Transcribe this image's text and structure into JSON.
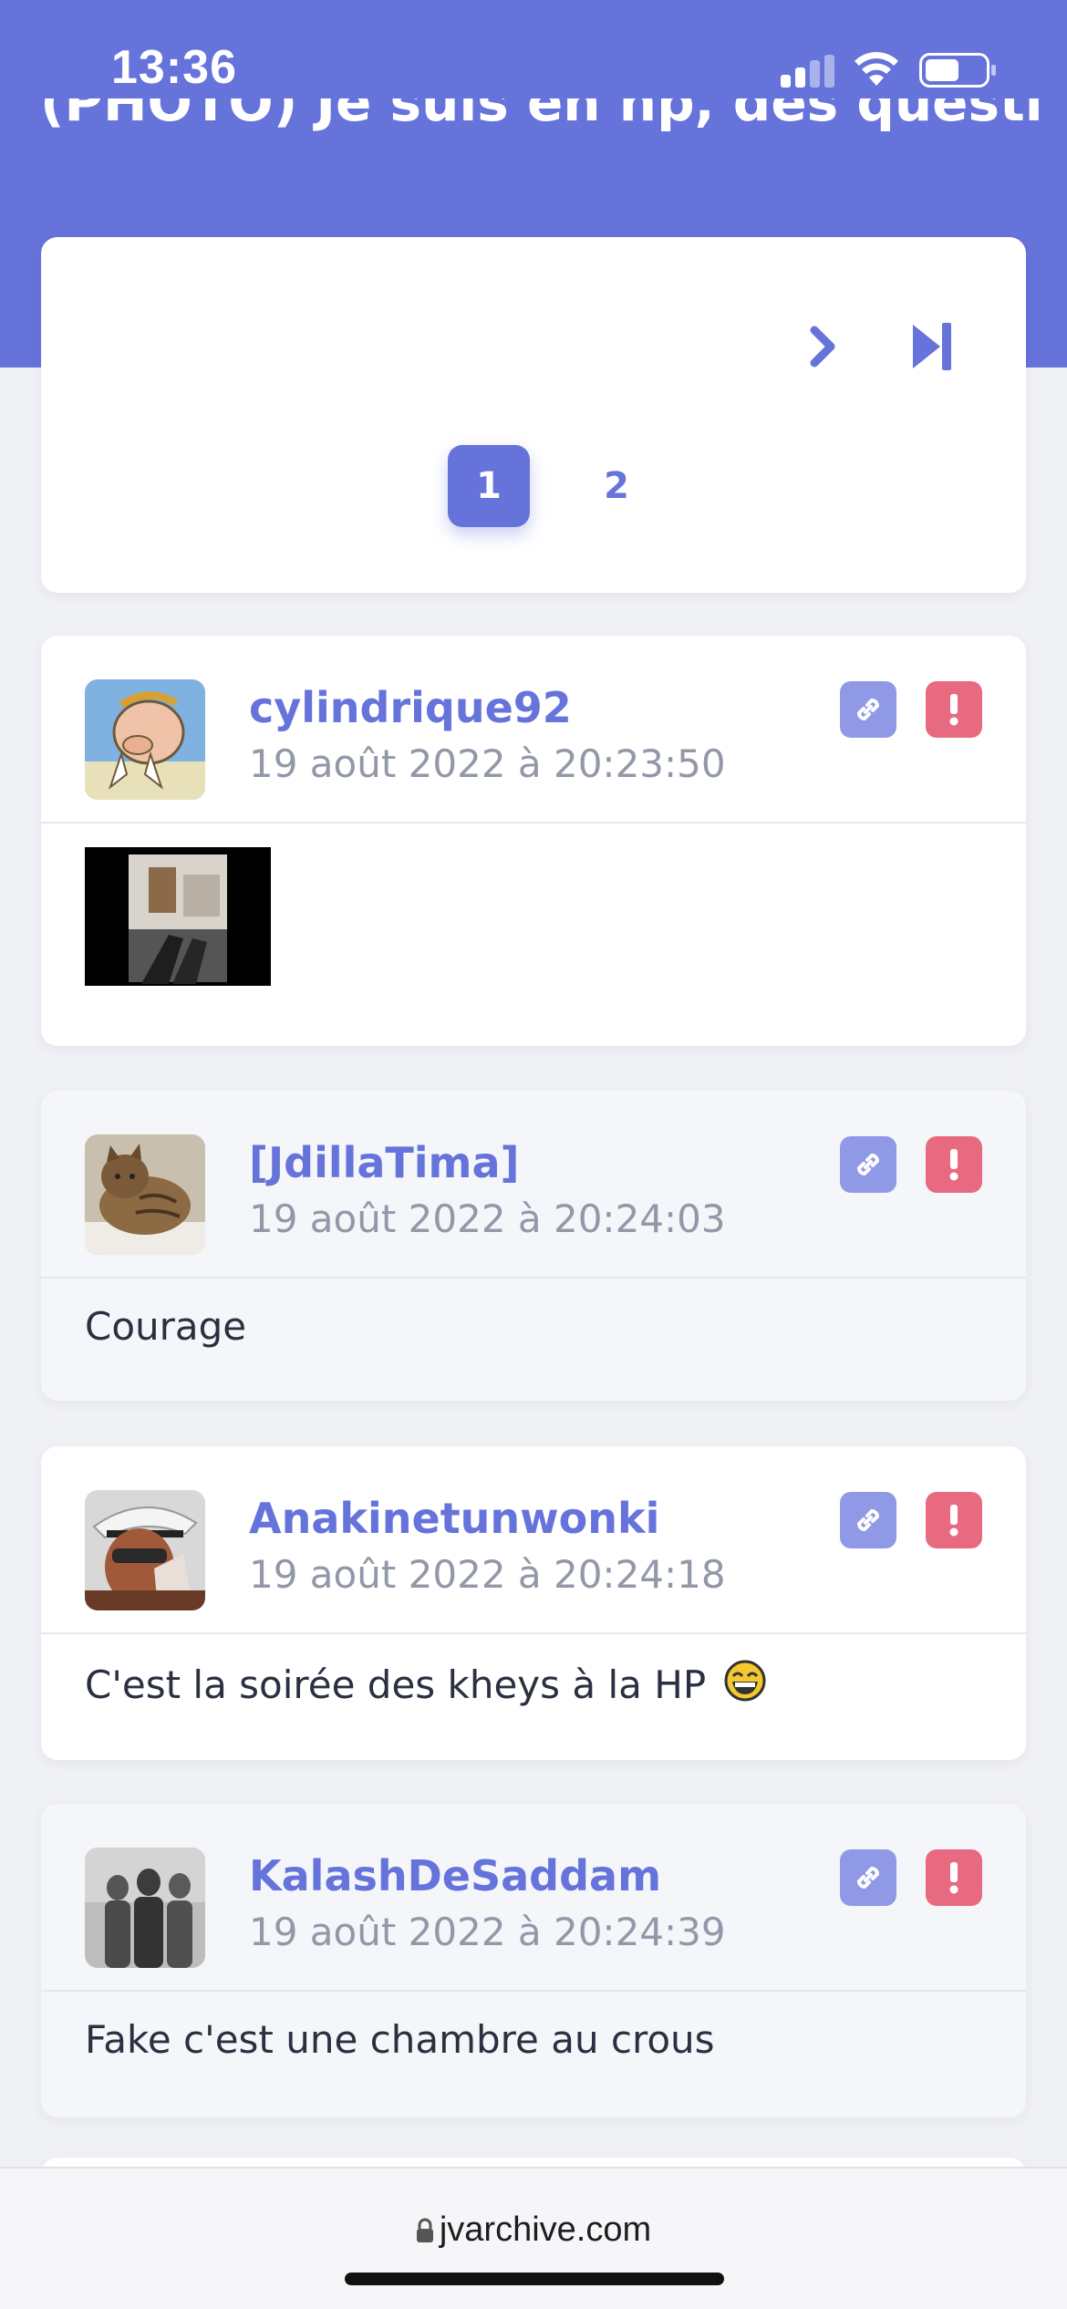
{
  "status_bar": {
    "time": "13:36"
  },
  "topic": {
    "title": "(PHOTO) Je suis en hp, des questions"
  },
  "pagination": {
    "pages": [
      "1",
      "2"
    ],
    "current": "1",
    "next_icon": "chevron-right-icon",
    "last_icon": "skip-to-end-icon"
  },
  "posts": [
    {
      "author": "cylindrique92",
      "date": "19 août 2022 à 20:23:50",
      "body": "",
      "has_image": true
    },
    {
      "author": "[JdillaTima]",
      "date": "19 août 2022 à 20:24:03",
      "body": "Courage"
    },
    {
      "author": "Anakinetunwonki",
      "date": "19 août 2022 à 20:24:18",
      "body": "C'est la soirée des kheys à la HP"
    },
    {
      "author": "KalashDeSaddam",
      "date": "19 août 2022 à 20:24:39",
      "body": "Fake c'est une chambre au crous"
    }
  ],
  "browser": {
    "url": "jvarchive.com"
  },
  "colors": {
    "accent": "#6573db",
    "report": "#e86a80",
    "link_button": "#8f99e6"
  }
}
